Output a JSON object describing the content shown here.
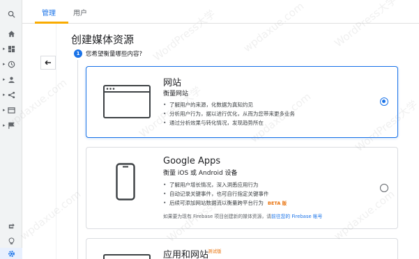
{
  "tabs": [
    {
      "label": "管理",
      "active": true
    },
    {
      "label": "用户",
      "active": false
    }
  ],
  "rail": {
    "icons": [
      "search-icon",
      "home-icon",
      "dashboard-icon",
      "clock-icon",
      "person-icon",
      "fork-icon",
      "display-icon",
      "flag-icon",
      "loop-icon",
      "lightbulb-icon",
      "gear-icon"
    ]
  },
  "page": {
    "title": "创建媒体资源",
    "step_number": "1",
    "step_question": "您希望衡量哪些内容?"
  },
  "cards": {
    "web": {
      "title": "网站",
      "subtitle": "衡量网站",
      "bullets": [
        "了解用户的来源，化数据为真知灼见",
        "分析用户行为，据以进行优化，从而为您带来更多业务",
        "通过分析效果与转化情况，发现趋势所在"
      ],
      "selected": true
    },
    "apps": {
      "title": "Google Apps",
      "subtitle": "衡量 iOS 或 Android 设备",
      "bullets": [
        "了解用户增长情况，深入洞悉应用行为",
        "自动记录关键事件，也可自行指定关键事件",
        "后续可添加网站数据流以衡量跨平台行为"
      ],
      "beta_label": "BETA 版",
      "footnote_prefix": "如果要为现有 Firebase 项目创建新的媒体资源，请",
      "footnote_link": "前往您的 Firebase 帐号",
      "selected": false
    },
    "both": {
      "title": "应用和网站",
      "badge": "测试版"
    }
  },
  "watermark": {
    "text_a": "WordPress大学",
    "text_b": "wpdaxue.com"
  },
  "colors": {
    "accent": "#1a73e8",
    "tab_underline": "#f9ab00",
    "beta": "#e8710a"
  }
}
